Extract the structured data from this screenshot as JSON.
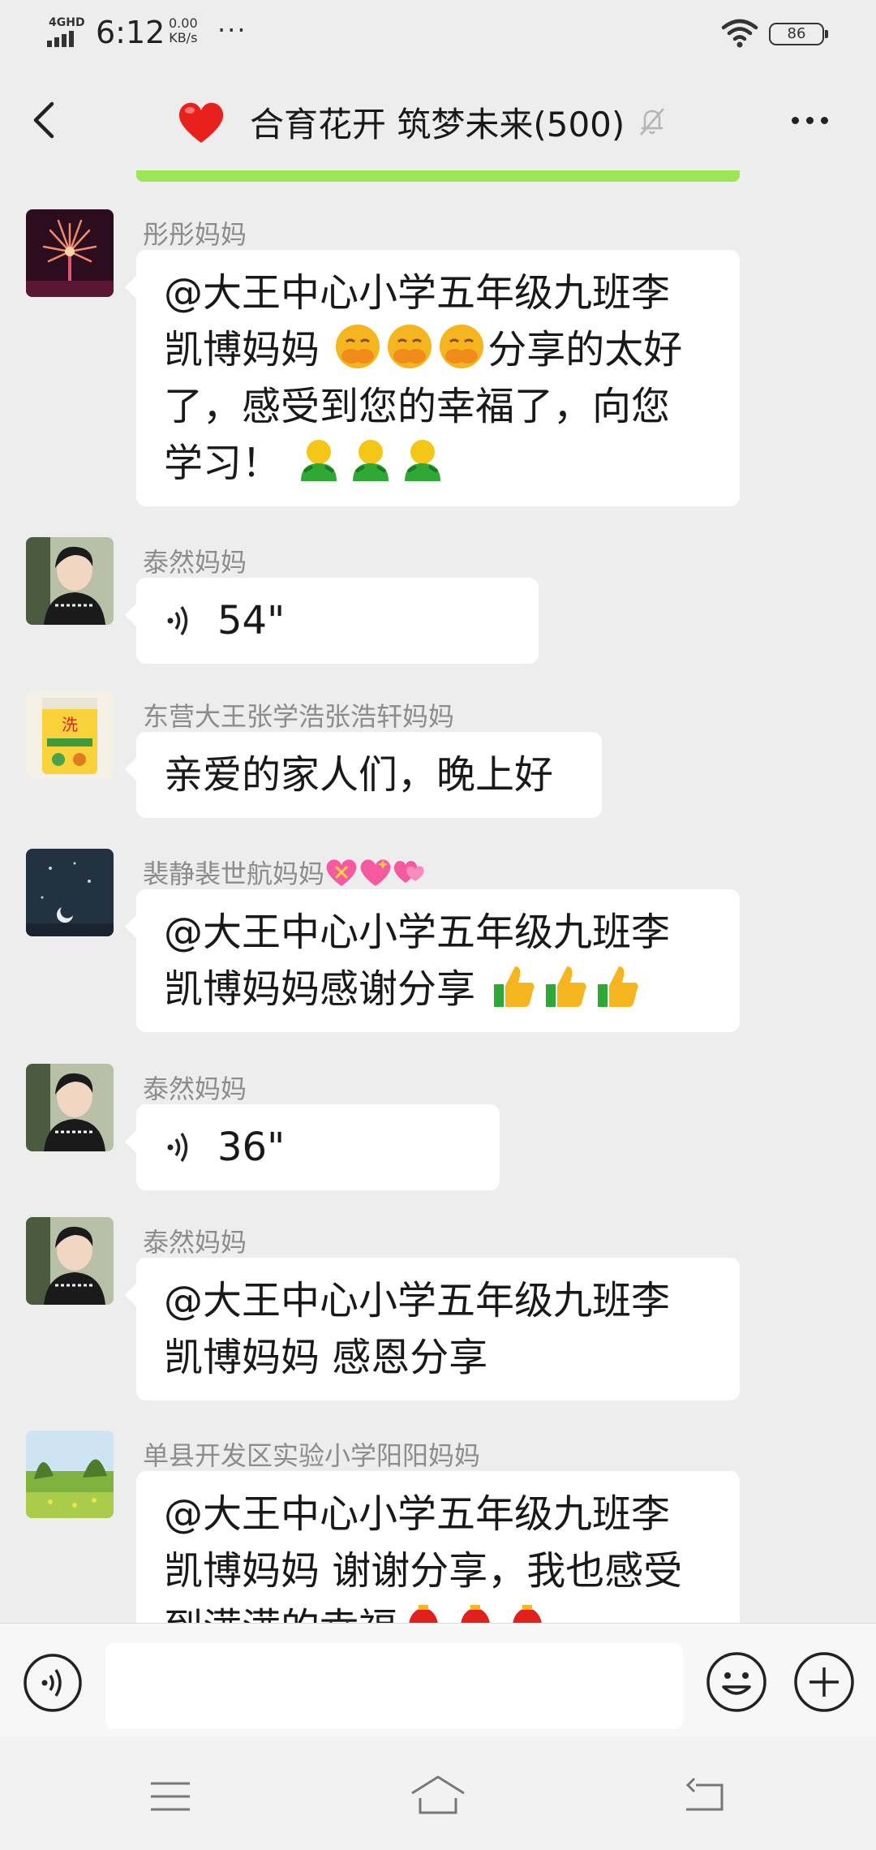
{
  "status_bar": {
    "network": "4GHD",
    "time": "6:12",
    "speed_value": "0.00",
    "speed_unit": "KB/s",
    "more": "···",
    "battery": "86"
  },
  "header": {
    "title": "合育花开 筑梦未来(500)"
  },
  "messages": [
    {
      "sender": "彤彤妈妈",
      "lines": [
        {
          "text": "@大王中心小学五年级九班李"
        },
        {
          "text": "凯博妈妈 ",
          "emoji": "face-with-hand-over-mouth",
          "count": 3,
          "after": "分享的太好"
        },
        {
          "text": "了，感受到您的幸福了，向您"
        },
        {
          "text": "学习！ ",
          "emoji": "green-hug-figure",
          "count": 3
        }
      ]
    },
    {
      "sender": "泰然妈妈",
      "voice_duration": "54\""
    },
    {
      "sender": "东营大王张学浩张浩轩妈妈",
      "lines": [
        {
          "text": "亲爱的家人们，晚上好"
        }
      ]
    },
    {
      "sender": "裴静裴世航妈妈",
      "sender_emoji": "heart-with-ribbon",
      "lines": [
        {
          "text": "@大王中心小学五年级九班李"
        },
        {
          "text": "凯博妈妈感谢分享 ",
          "emoji": "thumbs-up",
          "count": 3
        }
      ]
    },
    {
      "sender": "泰然妈妈",
      "voice_duration": "36\""
    },
    {
      "sender": "泰然妈妈",
      "lines": [
        {
          "text": "@大王中心小学五年级九班李"
        },
        {
          "text": "凯博妈妈  感恩分享"
        }
      ]
    },
    {
      "sender": "单县开发区实验小学阳阳妈妈",
      "lines": [
        {
          "text": "@大王中心小学五年级九班李"
        },
        {
          "text": "凯博妈妈  谢谢分享，我也感受"
        },
        {
          "text": "到满满的幸福",
          "emoji": "red-lantern",
          "count": 3
        }
      ]
    }
  ],
  "input": {
    "placeholder": ""
  },
  "colors": {
    "background": "#ededed",
    "bubble": "#ffffff",
    "accent_green": "#9ce554",
    "sender_gray": "#8c8c8c"
  },
  "icons": [
    "back-arrow-icon",
    "heart-icon",
    "mute-bell-icon",
    "more-dots-icon",
    "voice-icon",
    "emoji-icon",
    "plus-icon",
    "menu-icon",
    "home-icon",
    "back-nav-icon"
  ]
}
